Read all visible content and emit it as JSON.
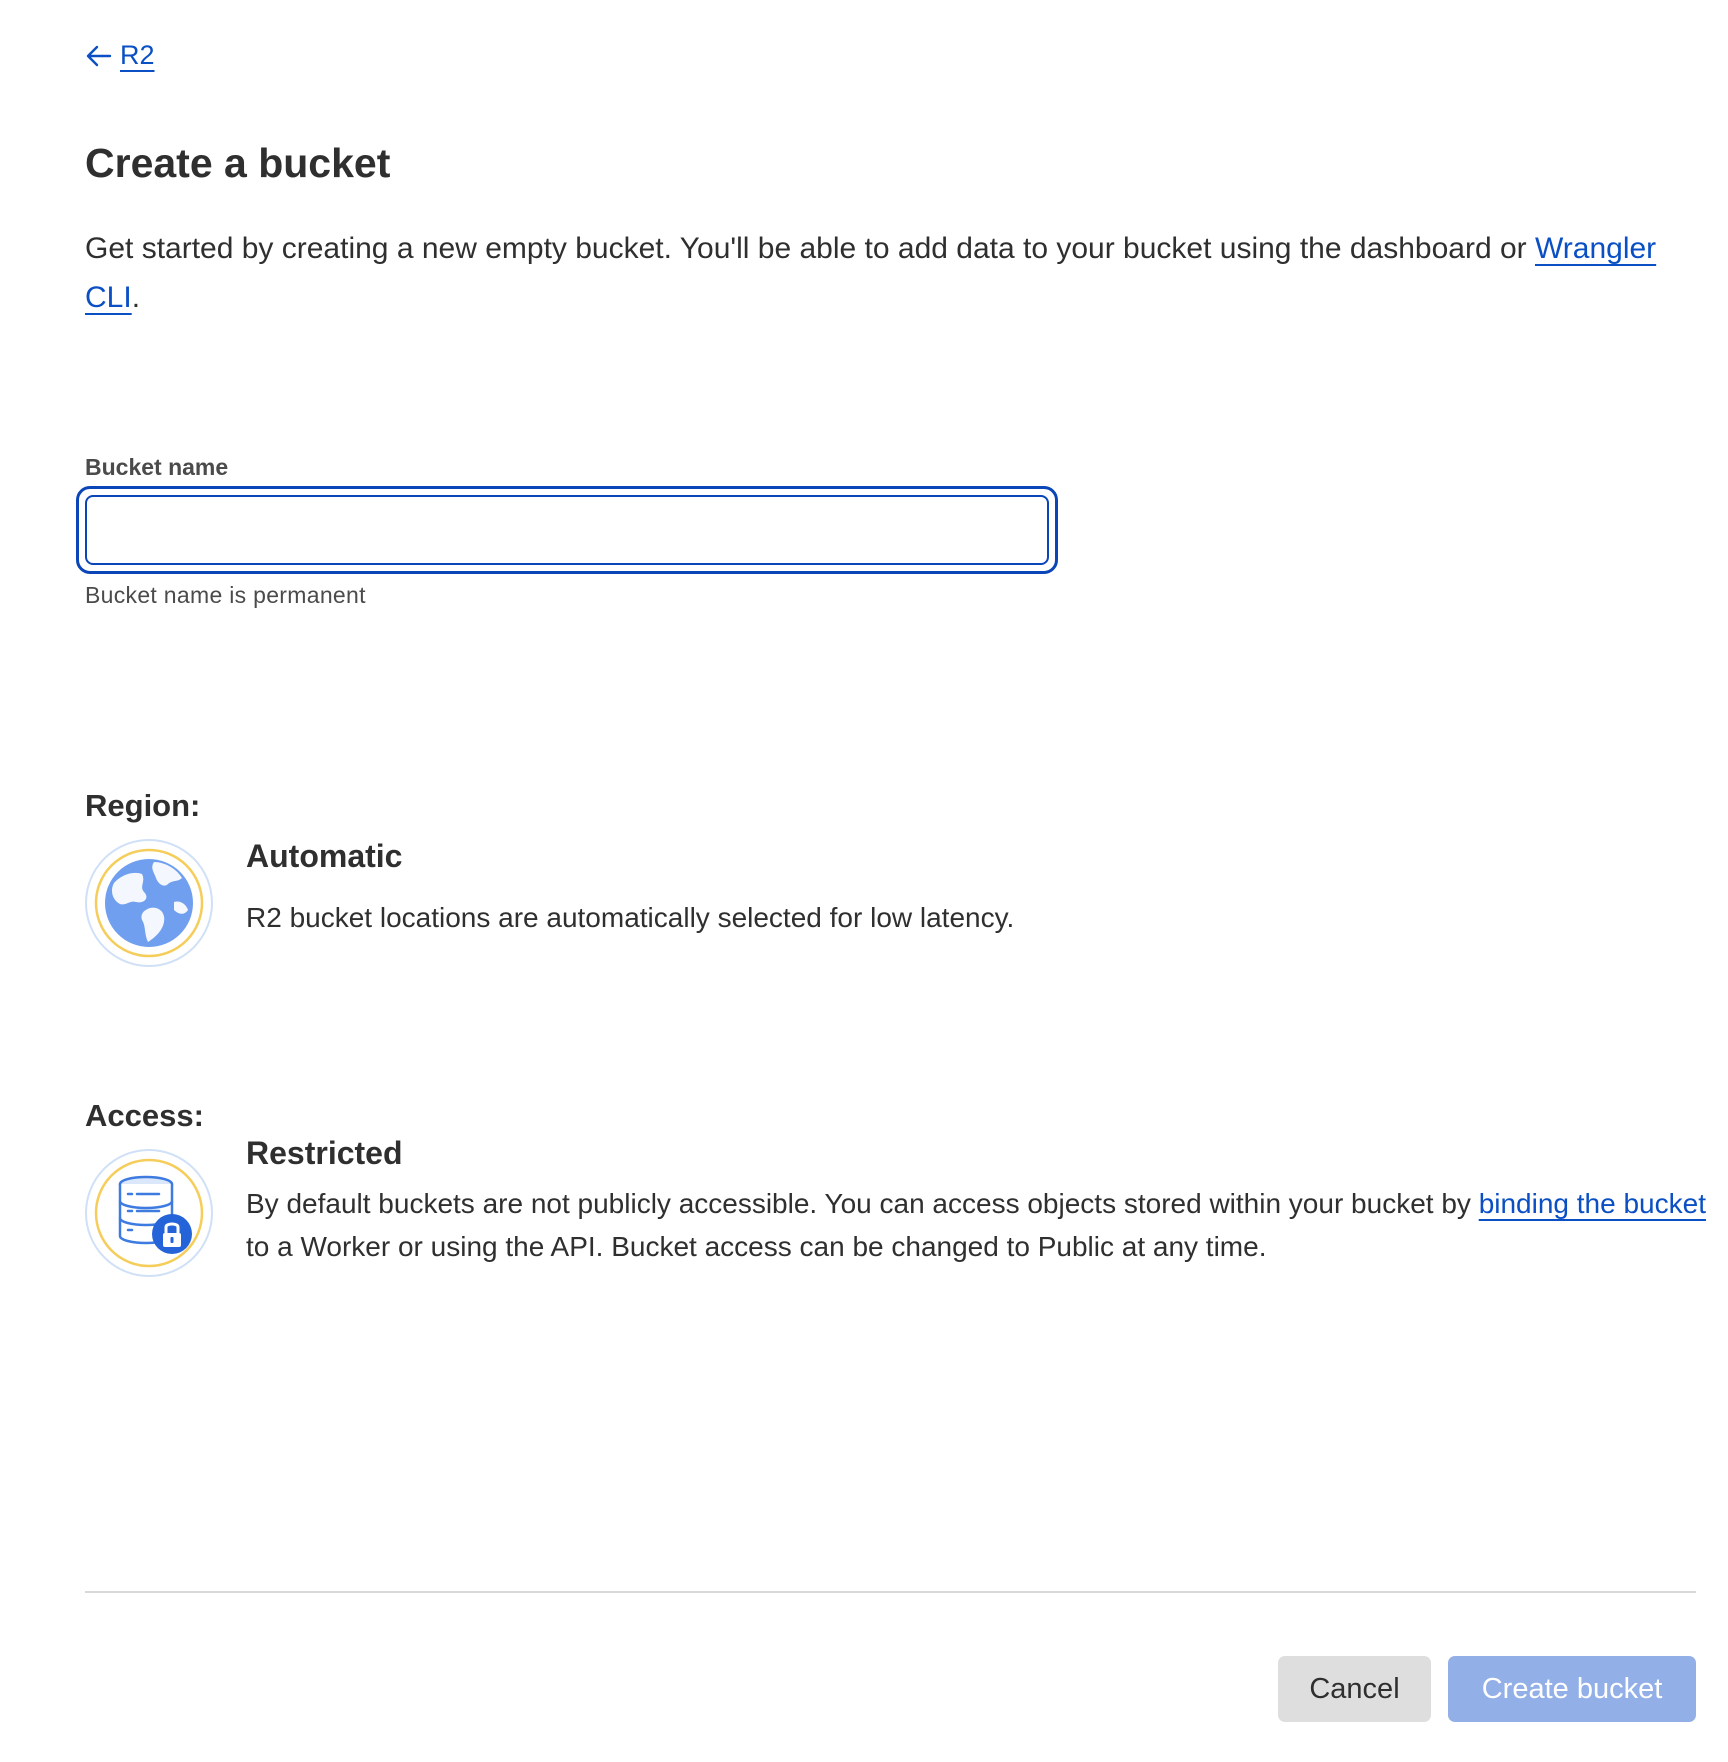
{
  "breadcrumb": {
    "back_label": "R2",
    "icon": "arrow-left-icon"
  },
  "header": {
    "title": "Create a bucket",
    "intro_text": "Get started by creating a new empty bucket. You'll be able to add data to your bucket using the dashboard or ",
    "intro_link": "Wrangler CLI",
    "intro_end": "."
  },
  "form": {
    "bucket_name_label": "Bucket name",
    "bucket_name_value": "",
    "bucket_name_placeholder": "",
    "bucket_name_helper": "Bucket name is permanent"
  },
  "region": {
    "section_title": "Region:",
    "icon": "globe-icon",
    "option_title": "Automatic",
    "option_description": "R2 bucket locations are automatically selected for low latency."
  },
  "access": {
    "section_title": "Access:",
    "icon": "database-lock-icon",
    "option_title": "Restricted",
    "description_before": "By default buckets are not publicly accessible. You can access objects stored within your bucket by ",
    "description_link": "binding the bucket",
    "description_after": " to a Worker or using the API. Bucket access can be changed to Public at any time."
  },
  "footer": {
    "cancel_label": "Cancel",
    "create_label": "Create bucket"
  },
  "colors": {
    "link": "#0a4fc4",
    "input_focus_border": "#0b46b8",
    "primary_button_disabled": "#93afe8",
    "secondary_button": "#dedede",
    "icon_ring_outer": "#cfe0f7",
    "icon_ring_inner": "#f5cd5a",
    "icon_blue": "#3d7be0"
  }
}
